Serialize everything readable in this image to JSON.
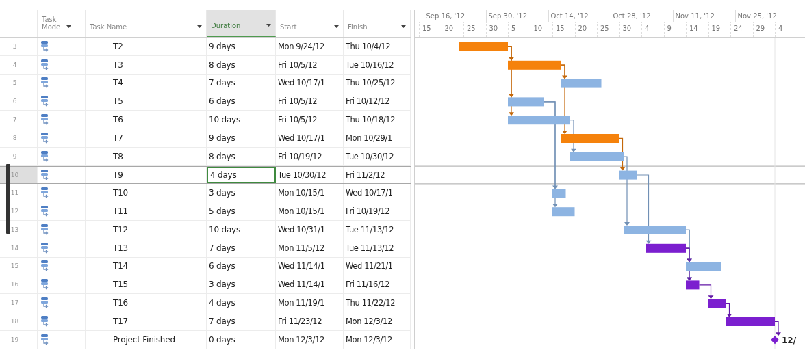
{
  "table": {
    "columns": [
      {
        "label": "Task Mode",
        "selected": false
      },
      {
        "label": "Task Name",
        "selected": false
      },
      {
        "label": "Duration",
        "selected": true
      },
      {
        "label": "Start",
        "selected": false
      },
      {
        "label": "Finish",
        "selected": false
      }
    ],
    "rows": [
      {
        "id": "3",
        "name": "T2",
        "duration": "9 days",
        "start": "Mon 9/24/12",
        "finish": "Thu 10/4/12",
        "selected": false,
        "kind": "task",
        "color": "#f5820c"
      },
      {
        "id": "4",
        "name": "T3",
        "duration": "8 days",
        "start": "Fri 10/5/12",
        "finish": "Tue 10/16/12",
        "selected": false,
        "kind": "task",
        "color": "#f5820c"
      },
      {
        "id": "5",
        "name": "T4",
        "duration": "7 days",
        "start": "Wed 10/17/1",
        "finish": "Thu 10/25/12",
        "selected": false,
        "kind": "task",
        "color": "#8db4e2"
      },
      {
        "id": "6",
        "name": "T5",
        "duration": "6 days",
        "start": "Fri 10/5/12",
        "finish": "Fri 10/12/12",
        "selected": false,
        "kind": "task",
        "color": "#8db4e2"
      },
      {
        "id": "7",
        "name": "T6",
        "duration": "10 days",
        "start": "Fri 10/5/12",
        "finish": "Thu 10/18/12",
        "selected": false,
        "kind": "task",
        "color": "#8db4e2"
      },
      {
        "id": "8",
        "name": "T7",
        "duration": "9 days",
        "start": "Wed 10/17/1",
        "finish": "Mon 10/29/1",
        "selected": false,
        "kind": "task",
        "color": "#f5820c"
      },
      {
        "id": "9",
        "name": "T8",
        "duration": "8 days",
        "start": "Fri 10/19/12",
        "finish": "Tue 10/30/12",
        "selected": false,
        "kind": "task",
        "color": "#8db4e2"
      },
      {
        "id": "10",
        "name": "T9",
        "duration": "4 days",
        "start": "Tue 10/30/12",
        "finish": "Fri 11/2/12",
        "selected": true,
        "kind": "task",
        "color": "#8db4e2"
      },
      {
        "id": "11",
        "name": "T10",
        "duration": "3 days",
        "start": "Mon 10/15/1",
        "finish": "Wed 10/17/1",
        "selected": false,
        "kind": "task",
        "color": "#8db4e2"
      },
      {
        "id": "12",
        "name": "T11",
        "duration": "5 days",
        "start": "Mon 10/15/1",
        "finish": "Fri 10/19/12",
        "selected": false,
        "kind": "task",
        "color": "#8db4e2"
      },
      {
        "id": "13",
        "name": "T12",
        "duration": "10 days",
        "start": "Wed 10/31/1",
        "finish": "Tue 11/13/12",
        "selected": false,
        "kind": "task",
        "color": "#8db4e2"
      },
      {
        "id": "14",
        "name": "T13",
        "duration": "7 days",
        "start": "Mon 11/5/12",
        "finish": "Tue 11/13/12",
        "selected": false,
        "kind": "task",
        "color": "#7b1fcf"
      },
      {
        "id": "15",
        "name": "T14",
        "duration": "6 days",
        "start": "Wed 11/14/1",
        "finish": "Wed 11/21/1",
        "selected": false,
        "kind": "task",
        "color": "#8db4e2"
      },
      {
        "id": "16",
        "name": "T15",
        "duration": "3 days",
        "start": "Wed 11/14/1",
        "finish": "Fri 11/16/12",
        "selected": false,
        "kind": "task",
        "color": "#7b1fcf"
      },
      {
        "id": "17",
        "name": "T16",
        "duration": "4 days",
        "start": "Mon 11/19/1",
        "finish": "Thu 11/22/12",
        "selected": false,
        "kind": "task",
        "color": "#7b1fcf"
      },
      {
        "id": "18",
        "name": "T17",
        "duration": "7 days",
        "start": "Fri 11/23/12",
        "finish": "Mon 12/3/12",
        "selected": false,
        "kind": "task",
        "color": "#7b1fcf"
      },
      {
        "id": "19",
        "name": "Project Finished",
        "duration": "0 days",
        "start": "Mon 12/3/12",
        "finish": "Mon 12/3/12",
        "selected": false,
        "kind": "milestone",
        "color": "#7b1fcf",
        "label": "12/"
      }
    ]
  },
  "timescale": {
    "major": [
      "Sep 16, '12",
      "Sep 30, '12",
      "Oct 14, '12",
      "Oct 28, '12",
      "Nov 11, '12",
      "Nov 25, '12"
    ],
    "minor": [
      "15",
      "20",
      "25",
      "30",
      "5",
      "10",
      "15",
      "20",
      "25",
      "30",
      "4",
      "9",
      "14",
      "19",
      "24",
      "29",
      "4"
    ]
  }
}
